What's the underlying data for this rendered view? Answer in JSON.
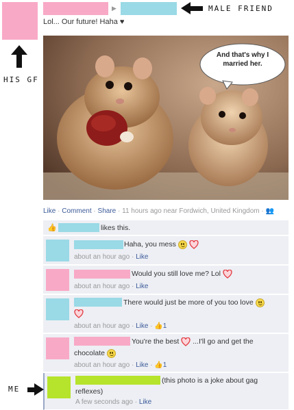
{
  "annotations": {
    "male_friend": "MALE FRIEND",
    "his_gf": "HIS GF",
    "me": "ME"
  },
  "post": {
    "text": "Lol... Our future! Haha ♥",
    "photo_caption": "And that's why I married her.",
    "meta": {
      "like": "Like",
      "comment": "Comment",
      "share": "Share",
      "time": "11 hours ago near Fordwich, United Kingdom",
      "sep": "·"
    }
  },
  "likes": {
    "text": "likes this."
  },
  "comments": [
    {
      "text": "Haha, you mess",
      "time": "about an hour ago",
      "like": "Like",
      "likes": ""
    },
    {
      "text": "Would you still love me? Lol",
      "time": "about an hour ago",
      "like": "Like",
      "likes": ""
    },
    {
      "text": "There would just be more of you too love",
      "time": "about an hour ago",
      "like": "Like",
      "likes": "1"
    },
    {
      "text": "You're the best",
      "text2": "...I'll go and get the",
      "text3": "chocolate",
      "time": "about an hour ago",
      "like": "Like",
      "likes": "1"
    },
    {
      "text": "(this photo is a joke about gag",
      "text2": "reflexes)",
      "time": "A few seconds ago",
      "like": "Like",
      "likes": ""
    }
  ],
  "colors": {
    "pink": "#f8a9c6",
    "blue": "#9ad9e6",
    "green": "#b6e32b",
    "link": "#3b5998"
  }
}
